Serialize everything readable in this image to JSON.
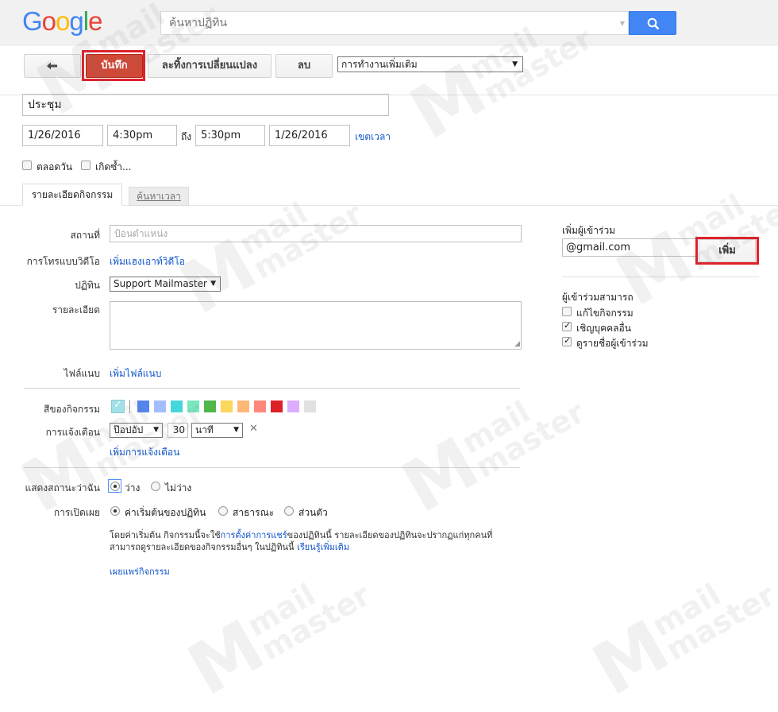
{
  "header": {
    "logo": "Google",
    "logo_colors": [
      "#4285f4",
      "#ea4335",
      "#fbbc05",
      "#4285f4",
      "#34a853",
      "#ea4335"
    ],
    "search_placeholder": "ค้นหาปฏิทิน",
    "search_icon": "search-icon"
  },
  "toolbar": {
    "back_icon": "back-arrow-icon",
    "save_label": "บันทึก",
    "discard_label": "ละทิ้งการเปลี่ยนแปลง",
    "delete_label": "ลบ",
    "more_actions_label": "การทำงานเพิ่มเติม"
  },
  "event": {
    "title": "ประชุม",
    "start_date": "1/26/2016",
    "start_time": "4:30pm",
    "to_label": "ถึง",
    "end_time": "5:30pm",
    "end_date": "1/26/2016",
    "timezone_link": "เขตเวลา",
    "all_day_label": "ตลอดวัน",
    "repeat_label": "เกิดซ้ำ..."
  },
  "tabs": {
    "details": "รายละเอียดกิจกรรม",
    "find_time": "ค้นหาเวลา"
  },
  "details": {
    "location_label": "สถานที่",
    "location_placeholder": "ป้อนตำแหน่ง",
    "video_call_label": "การโทรแบบวิดีโอ",
    "video_call_link": "เพิ่มแฮงเอาท์วิดีโอ",
    "calendar_label": "ปฏิทิน",
    "calendar_value": "Support Mailmaster",
    "description_label": "รายละเอียด",
    "attachment_label": "ไฟล์แนบ",
    "attachment_link": "เพิ่มไฟล์แนบ",
    "color_label": "สีของกิจกรรม",
    "colors": [
      "#a4e0ea",
      "#5484ed",
      "#a4bdfc",
      "#46d6db",
      "#7ae7bf",
      "#51b749",
      "#fbd75b",
      "#ffb878",
      "#ff887c",
      "#dc2127",
      "#dbadff",
      "#e1e1e1"
    ],
    "reminder_label": "การแจ้งเตือน",
    "reminder_type": "ป๊อปอัป",
    "reminder_minutes": "30",
    "reminder_unit": "นาที",
    "add_reminder_link": "เพิ่มการแจ้งเตือน",
    "show_as_label": "แสดงสถานะว่าฉัน",
    "busy_label": "ว่าง",
    "free_label": "ไม่ว่าง",
    "visibility_label": "การเปิดเผย",
    "visibility_default": "ค่าเริ่มต้นของปฏิทิน",
    "visibility_public": "สาธารณะ",
    "visibility_private": "ส่วนตัว",
    "privacy_note_1": "โดยค่าเริ่มต้น กิจกรรมนี้จะใช้",
    "privacy_note_link": "การตั้งค่าการแชร์",
    "privacy_note_2": "ของปฏิทินนี้ รายละเอียดของปฏิทินจะปรากฏแก่ทุกคนที่สามารถดูรายละเอียดของกิจกรรมอื่นๆ ในปฏิทินนี้",
    "learn_more_link": "เรียนรู้เพิ่มเติม",
    "publish_link": "เผยแพร่กิจกรรม"
  },
  "guests": {
    "title": "เพิ่มผู้เข้าร่วม",
    "input_value": "@gmail.com",
    "add_button": "เพิ่ม",
    "permissions_title": "ผู้เข้าร่วมสามารถ",
    "perm_modify": "แก้ไขกิจกรรม",
    "perm_invite": "เชิญบุคคลอื่น",
    "perm_see_list": "ดูรายชื่อผู้เข้าร่วม"
  },
  "watermark": {
    "line1": "mail",
    "line2": "master"
  }
}
